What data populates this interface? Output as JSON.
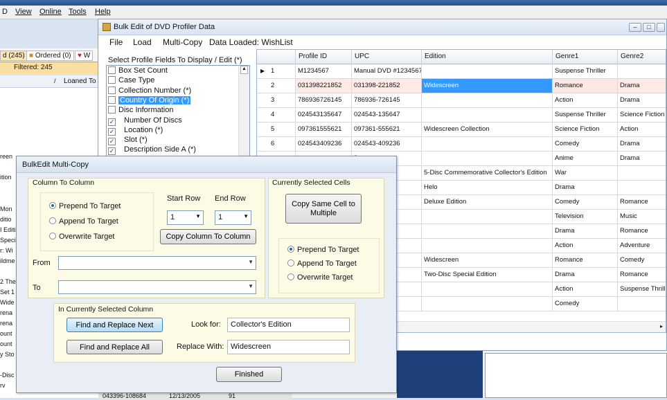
{
  "background_app": {
    "menu": [
      "D",
      "View",
      "Online",
      "Tools",
      "Help"
    ],
    "tabs": [
      "d (245)",
      "Ordered (0)",
      "W"
    ],
    "filtered": "Filtered: 245",
    "list_header": "Loaned To",
    "list_fragments": [
      "reen",
      "ition",
      "Mon",
      "ditio",
      "I Editi",
      "Speci",
      "r: Wi",
      "ildme",
      "2 The",
      "Set 1",
      "Wide",
      "rena",
      "rena",
      "ount",
      "ount",
      "y Sto",
      "-Disc",
      "rv"
    ],
    "bottom_row": [
      "043396-108684",
      "12/13/2005",
      "91"
    ]
  },
  "bulk_window": {
    "title": "Bulk Edit of DVD Profiler Data",
    "menu": [
      "File",
      "Load",
      "Multi-Copy",
      "Data Loaded: WishList"
    ],
    "fields_label": "Select Profile Fields To Display / Edit (*)",
    "fields": [
      {
        "label": "Box Set Count",
        "checked": false,
        "indent": false,
        "selected": false
      },
      {
        "label": "Case Type",
        "checked": false,
        "indent": false,
        "selected": false
      },
      {
        "label": "Collection Number (*)",
        "checked": false,
        "indent": false,
        "selected": false
      },
      {
        "label": "Country Of Origin (*)",
        "checked": false,
        "indent": false,
        "selected": true
      },
      {
        "label": "Disc Information",
        "checked": false,
        "indent": false,
        "selected": false
      },
      {
        "label": "Number Of Discs",
        "checked": true,
        "indent": true,
        "selected": false
      },
      {
        "label": "Location (*)",
        "checked": true,
        "indent": true,
        "selected": false
      },
      {
        "label": "Slot (*)",
        "checked": true,
        "indent": true,
        "selected": false
      },
      {
        "label": "Description Side A (*)",
        "checked": true,
        "indent": true,
        "selected": false
      }
    ],
    "grid": {
      "columns": [
        "",
        "Profile ID",
        "UPC",
        "Edition",
        "Genre1",
        "Genre2"
      ],
      "rows": [
        [
          "1",
          "M1234567",
          "Manual DVD #1234567",
          "",
          "Suspense Thriller",
          ""
        ],
        [
          "2",
          "031398221852",
          "031398-221852",
          "Widescreen",
          "Romance",
          "Drama"
        ],
        [
          "3",
          "786936726145",
          "786936-726145",
          "",
          "Action",
          "Drama"
        ],
        [
          "4",
          "024543135647",
          "024543-135647",
          "",
          "Suspense Thriller",
          "Science Fiction"
        ],
        [
          "5",
          "097361555621",
          "097361-555621",
          "Widescreen Collection",
          "Science Fiction",
          "Action"
        ],
        [
          "6",
          "024543409236",
          "024543-409236",
          "",
          "Comedy",
          "Drama"
        ],
        [
          "",
          "",
          "3",
          "",
          "Anime",
          "Drama"
        ],
        [
          "",
          "",
          "4",
          "5-Disc Commemorative Collector's Edition",
          "War",
          ""
        ],
        [
          "",
          "",
          "",
          "Helo",
          "Drama",
          ""
        ],
        [
          "",
          "",
          "9",
          "Deluxe Edition",
          "Comedy",
          "Romance"
        ],
        [
          "",
          "",
          "74",
          "",
          "Television",
          "Music"
        ],
        [
          "",
          "",
          "",
          "",
          "Drama",
          "Romance"
        ],
        [
          "",
          "",
          "4",
          "",
          "Action",
          "Adventure"
        ],
        [
          "",
          "",
          "6",
          "Widescreen",
          "Romance",
          "Comedy"
        ],
        [
          "",
          "",
          "2",
          "Two-Disc Special Edition",
          "Drama",
          "Romance"
        ],
        [
          "",
          "",
          "",
          "",
          "Action",
          "Suspense Thrill"
        ],
        [
          "",
          "",
          "3",
          "",
          "Comedy",
          ""
        ]
      ]
    }
  },
  "multicopy": {
    "title": "BulkEdit Multi-Copy",
    "col_to_col": {
      "title": "Column To Column",
      "options": [
        "Prepend To Target",
        "Append To Target",
        "Overwrite Target"
      ],
      "selected": 0,
      "start_row_label": "Start Row",
      "end_row_label": "End Row",
      "start_row": "1",
      "end_row": "1",
      "copy_button": "Copy Column To Column",
      "from_label": "From",
      "to_label": "To",
      "from_value": "",
      "to_value": ""
    },
    "selected_cells": {
      "title": "Currently Selected Cells",
      "copy_button": "Copy Same Cell to Multiple",
      "options": [
        "Prepend To Target",
        "Append To Target",
        "Overwrite Target"
      ],
      "selected": 0
    },
    "in_column": {
      "title": "In Currently Selected Column",
      "find_next": "Find and Replace Next",
      "find_all": "Find and Replace All",
      "look_for_label": "Look for:",
      "look_for_value": "Collector's Edition",
      "replace_with_label": "Replace With:",
      "replace_with_value": "Widescreen"
    },
    "finished": "Finished"
  }
}
